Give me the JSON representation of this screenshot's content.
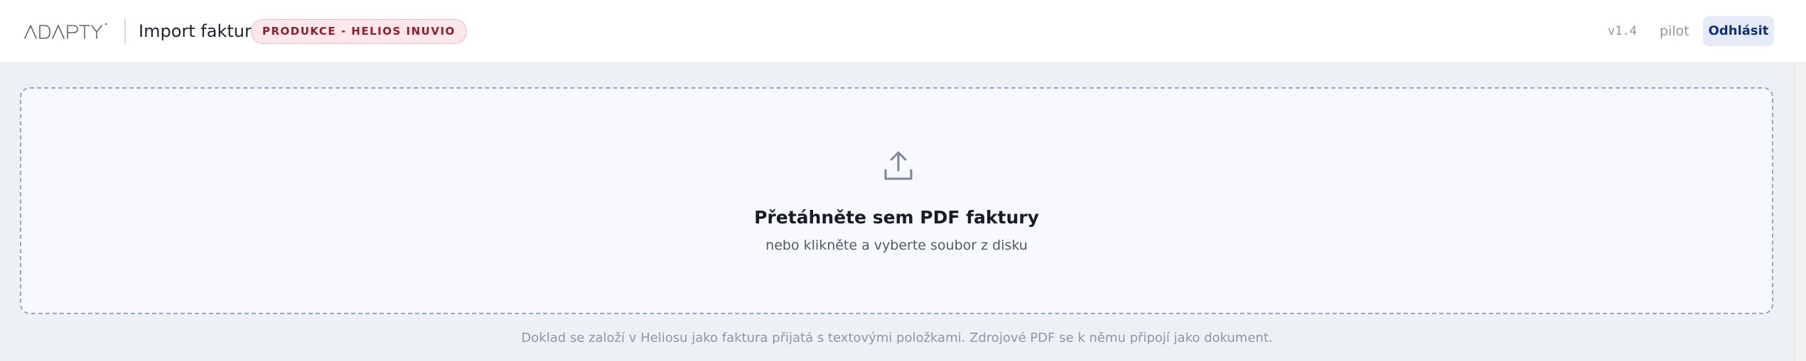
{
  "header": {
    "logo_text": "ADAPTY",
    "app_title": "Import faktur",
    "environment_badge": "PRODUKCE - HELIOS INUVIO",
    "version": "v1.4",
    "user": "pilot",
    "logout_label": "Odhlásit"
  },
  "dropzone": {
    "icon": "upload-icon",
    "title": "Přetáhněte sem PDF faktury",
    "subtitle": "nebo klikněte a vyberte soubor z disku"
  },
  "footer": {
    "note": "Doklad se založí v Heliosu jako faktura přijatá s textovými položkami. Zdrojové PDF se k němu připojí jako dokument."
  },
  "colors": {
    "page_background": "#edf0f5",
    "badge_background": "#fce7ea",
    "badge_text": "#8f1d2c",
    "logout_background": "#e5ebf7",
    "logout_text": "#14307a",
    "dropzone_border": "#93a7c8"
  }
}
